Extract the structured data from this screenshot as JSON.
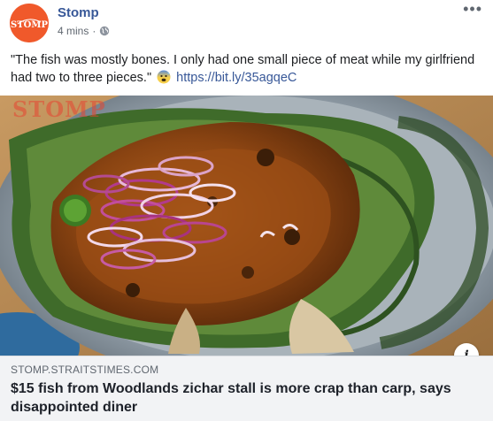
{
  "header": {
    "page_name": "Stomp",
    "avatar_text": "STOMP",
    "timestamp": "4 mins",
    "separator": "·",
    "privacy_icon": "globe-icon",
    "more_icon": "more-options-icon",
    "more_glyph": "•••"
  },
  "post": {
    "text": "\"The fish was mostly bones. I only had one small piece of meat while my girlfriend had two to three pieces.\"",
    "emoji": "anxious-face-with-sweat-icon",
    "link_text": "https://bit.ly/35agqeC"
  },
  "image": {
    "watermark": "STOMP",
    "info_icon": "info-icon",
    "info_glyph": "i"
  },
  "link_preview": {
    "domain": "STOMP.STRAITSTIMES.COM",
    "headline": "$15 fish from Woodlands zichar stall is more crap than carp, says disappointed diner"
  },
  "colors": {
    "brand": "#f0592b",
    "link": "#385898",
    "preview_bg": "#f2f3f5"
  }
}
